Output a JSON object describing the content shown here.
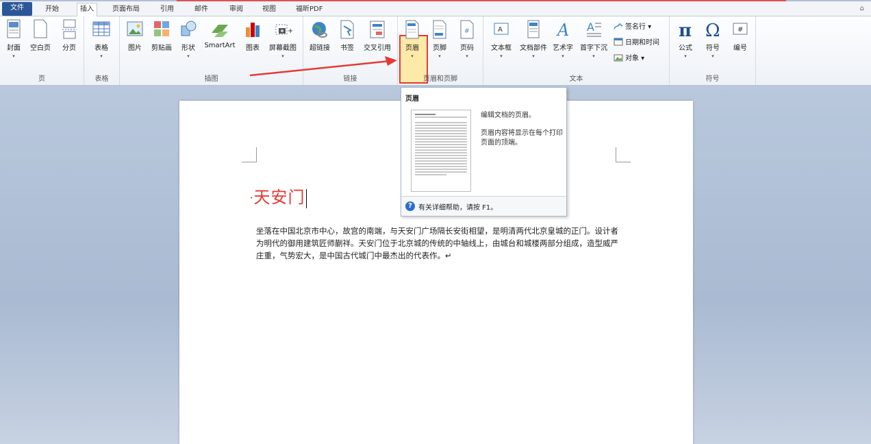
{
  "tabs": [
    "文件",
    "开始",
    "插入",
    "页面布局",
    "引用",
    "邮件",
    "审阅",
    "视图",
    "福昕PDF"
  ],
  "ribbon": {
    "groups": {
      "pages": "页",
      "tables": "表格",
      "illustrations": "插图",
      "links": "链接",
      "header_footer": "页眉和页脚",
      "text": "文本",
      "symbols": "符号"
    },
    "buttons": {
      "cover": "封面",
      "blank_page": "空白页",
      "page_break": "分页",
      "table": "表格",
      "picture": "图片",
      "clipart": "剪贴画",
      "shapes": "形状",
      "smartart": "SmartArt",
      "chart": "图表",
      "screenshot": "屏幕截图",
      "hyperlink": "超链接",
      "bookmark": "书签",
      "cross_ref": "交叉引用",
      "header": "页眉",
      "footer": "页脚",
      "page_number": "页码",
      "textbox": "文本框",
      "quick_parts": "文档部件",
      "wordart": "艺术字",
      "drop_cap": "首字下沉",
      "signature_line": "签名行 ▾",
      "date_time": "日期和时间",
      "object": "对象 ▾",
      "equation": "公式",
      "symbol": "符号",
      "number": "编号"
    }
  },
  "tooltip": {
    "title": "页眉",
    "line1": "编辑文档的页眉。",
    "line2": "页眉内容将显示在每个打印页面的顶端。",
    "footer": "有关详细帮助，请按 F1。"
  },
  "document": {
    "title": "天安门",
    "paragraph": "坐落在中国北京市中心，故宫的南端，与天安门广场隔长安街相望，是明清两代北京皇城的正门。设计者为明代的御用建筑匠师蒯祥。天安门位于北京城的传统的中轴线上，由城台和城楼两部分组成，造型威严庄重，气势宏大，是中国古代城门中最杰出的代表作。↵"
  },
  "colors": {
    "accent": "#2b5797",
    "title_red": "#e53935",
    "highlight_border": "#e53935"
  }
}
